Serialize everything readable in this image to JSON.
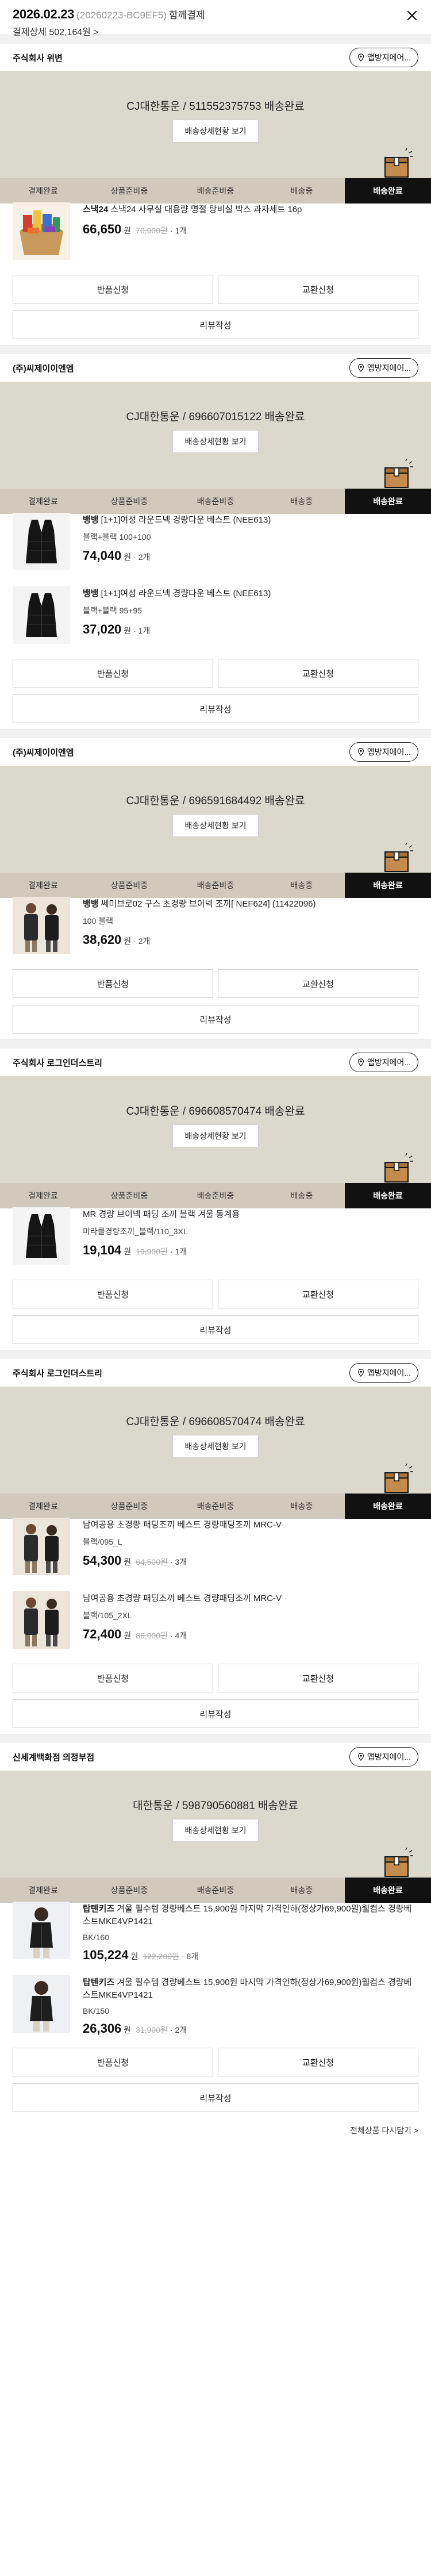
{
  "header": {
    "title": "2026.02.23",
    "order_no": "(20260223-BC9EF5)",
    "suffix": "함께결제",
    "payment": "결제상세 502,164원",
    "payment_chevron": ">"
  },
  "labels": {
    "track_button": "배송상세현황 보기",
    "return": "반품신청",
    "exchange": "교환신청",
    "review": "리뷰작성",
    "won": "원",
    "pill": "앱방지에어..."
  },
  "steps": [
    "결제완료",
    "상품준비중",
    "배송준비중",
    "배송중",
    "배송완료"
  ],
  "shops": [
    {
      "name": "주식회사 위변",
      "tracking": "CJ대한통운 / 511552375753 배송완료",
      "items": [
        {
          "brand": "스낵24",
          "title": "스낵24 사무실 대용량 명절 탕비실 박스 과자세트 16p",
          "option": "",
          "price": "66,650",
          "original": "70,900원",
          "qty": "1개",
          "thumb": "snack"
        }
      ]
    },
    {
      "name": "(주)씨제이이엔엠",
      "tracking": "CJ대한통운 / 696607015122 배송완료",
      "items": [
        {
          "brand": "뱅뱅",
          "title": "[1+1]여성 라운드넥 경량다운 베스트 (NEE613)",
          "option": "블랙+블랙 100+100",
          "price": "74,040",
          "original": "",
          "qty": "2개",
          "thumb": "vest"
        },
        {
          "brand": "뱅뱅",
          "title": "[1+1]여성 라운드넥 경량다운 베스트 (NEE613)",
          "option": "블랙+블랙 95+95",
          "price": "37,020",
          "original": "",
          "qty": "1개",
          "thumb": "vest"
        }
      ]
    },
    {
      "name": "(주)씨제이이엔엠",
      "tracking": "CJ대한통운 / 696591684492 배송완료",
      "items": [
        {
          "brand": "뱅뱅",
          "title": "쎄미브로02 구스 초경량 브이넥 조끼[ NEF624] (11422096)",
          "option": "100 블랙",
          "price": "38,620",
          "original": "",
          "qty": "2개",
          "thumb": "couple"
        }
      ]
    },
    {
      "name": "주식회사 로그인더스트리",
      "tracking": "CJ대한통운 / 696608570474 배송완료",
      "items": [
        {
          "brand": "",
          "title": "MR 경량 브이넥 패딩 조끼 블랙 겨울 동계용",
          "option": "미라클경량조끼_블랙/110_3XL",
          "price": "19,104",
          "original": "19,900원",
          "qty": "1개",
          "thumb": "vest"
        }
      ]
    },
    {
      "name": "주식회사 로그인더스트리",
      "tracking": "CJ대한통운 / 696608570474 배송완료",
      "items": [
        {
          "brand": "",
          "title": "남여공용 초경량 패딩조끼 베스트 경량패딩조끼 MRC-V",
          "option": "블랙/095_L",
          "price": "54,300",
          "original": "64,500원",
          "qty": "3개",
          "thumb": "couple"
        },
        {
          "brand": "",
          "title": "남여공용 초경량 패딩조끼 베스트 경량패딩조끼 MRC-V",
          "option": "블랙/105_2XL",
          "price": "72,400",
          "original": "86,000원",
          "qty": "4개",
          "thumb": "couple"
        }
      ]
    },
    {
      "name": "신세계백화점 의정부점",
      "tracking": "대한통운 / 598790560881 배송완료",
      "items": [
        {
          "brand": "탑텐키즈",
          "title": "겨울 필수템 경량베스트 15,900원 마지막 가격인하(정상가69,900원)웰컴스 경량베스트MKE4VP1421",
          "option": "BK/160",
          "price": "105,224",
          "original": "122,200원",
          "qty": "8개",
          "thumb": "kid"
        },
        {
          "brand": "탑텐키즈",
          "title": "겨울 필수템 경량베스트 15,900원 마지막 가격인하(정상가69,900원)웰컴스 경량베스트MKE4VP1421",
          "option": "BK/150",
          "price": "26,306",
          "original": "31,900원",
          "qty": "2개",
          "thumb": "kid"
        }
      ]
    }
  ],
  "footer": {
    "link": "전체상품 다시담기 >"
  }
}
